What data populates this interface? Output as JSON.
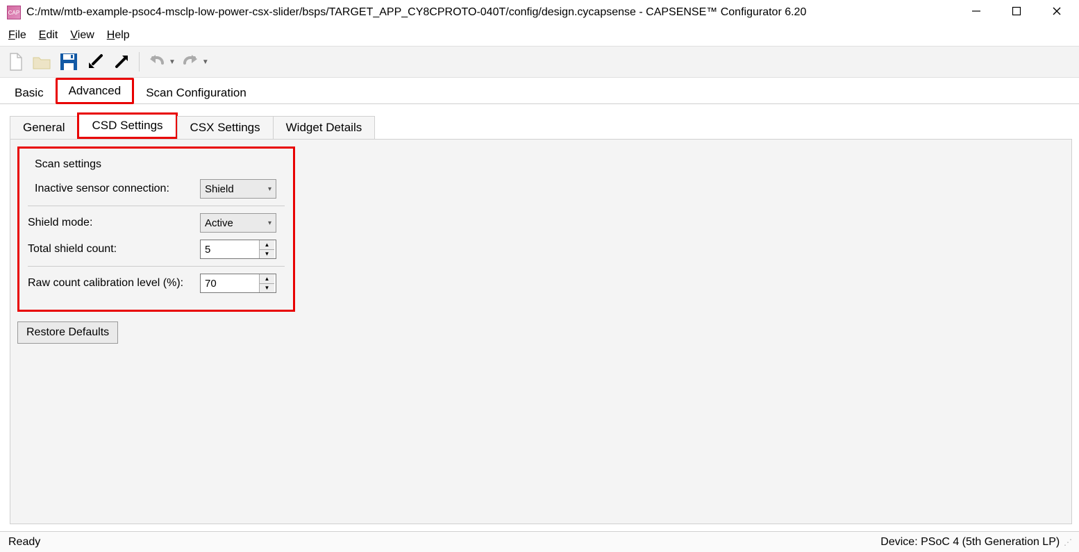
{
  "window": {
    "title": "C:/mtw/mtb-example-psoc4-msclp-low-power-csx-slider/bsps/TARGET_APP_CY8CPROTO-040T/config/design.cycapsense - CAPSENSE™ Configurator 6.20",
    "app_icon_label": "CAP"
  },
  "menu": {
    "file": "File",
    "edit": "Edit",
    "view": "View",
    "help": "Help"
  },
  "toolbar": {
    "new": "new",
    "open": "open",
    "save": "save",
    "import": "import",
    "export": "export",
    "undo": "undo",
    "redo": "redo"
  },
  "main_tabs": {
    "basic": "Basic",
    "advanced": "Advanced",
    "scan_config": "Scan Configuration"
  },
  "sub_tabs": {
    "general": "General",
    "csd": "CSD Settings",
    "csx": "CSX Settings",
    "widget": "Widget Details"
  },
  "panel": {
    "scan_settings_title": "Scan settings",
    "inactive_label": "Inactive sensor connection:",
    "inactive_value": "Shield",
    "shield_mode_label": "Shield mode:",
    "shield_mode_value": "Active",
    "shield_count_label": "Total shield count:",
    "shield_count_value": "5",
    "raw_count_label": "Raw count calibration level (%):",
    "raw_count_value": "70",
    "restore_defaults": "Restore Defaults"
  },
  "status": {
    "ready": "Ready",
    "device": "Device: PSoC 4 (5th Generation LP)"
  }
}
